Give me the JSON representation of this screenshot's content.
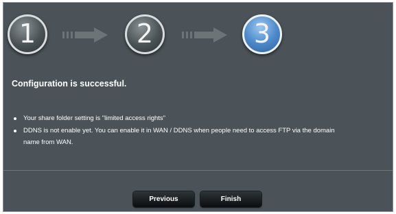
{
  "wizard": {
    "steps": [
      {
        "number": "1",
        "state": "inactive"
      },
      {
        "number": "2",
        "state": "inactive"
      },
      {
        "number": "3",
        "state": "active"
      }
    ],
    "headline": "Configuration is successful.",
    "bullets": [
      "Your share folder setting is \"limited access rights\"",
      "DDNS is not enable yet. You can enable it in WAN / DDNS when people need to access FTP via the domain name from WAN."
    ],
    "buttons": {
      "previous_label": "Previous",
      "finish_label": "Finish"
    }
  },
  "colors": {
    "panel_background": "#4b5358",
    "active_step": "#4f8ccd",
    "inactive_step": "#4b5256",
    "button": "#15191b"
  }
}
